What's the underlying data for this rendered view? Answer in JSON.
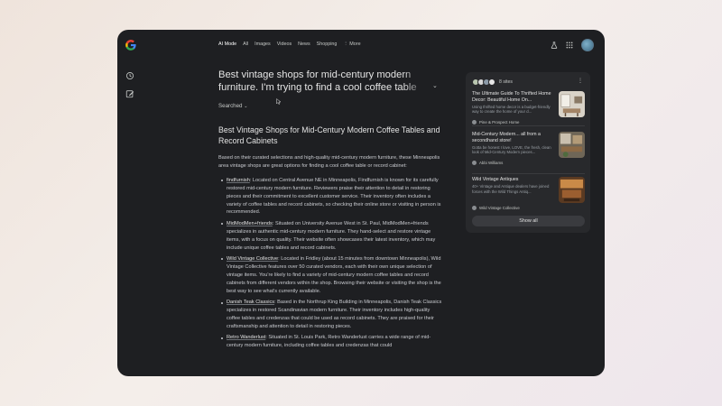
{
  "nav": {
    "tabs": [
      {
        "label": "AI Mode",
        "active": true
      },
      {
        "label": "All",
        "active": false
      },
      {
        "label": "Images",
        "active": false
      },
      {
        "label": "Videos",
        "active": false
      },
      {
        "label": "News",
        "active": false
      },
      {
        "label": "Shopping",
        "active": false
      },
      {
        "label": "⋮ More",
        "active": false
      }
    ]
  },
  "query": "Best vintage shops for mid-century modern furniture. I'm trying to find a cool coffee table or record cabinet",
  "searched_label": "Searched",
  "answer": {
    "title": "Best Vintage Shops for Mid-Century Modern Coffee Tables and Record Cabinets",
    "intro": "Based on their curated selections and high-quality mid-century modern furniture, these Minneapolis area vintage shops are great options for finding a cool coffee table or record cabinet:",
    "items": [
      {
        "name": "findfurnish",
        "text": ": Located on Central Avenue NE in Minneapolis, Findfurnish is known for its carefully restored mid-century modern furniture. Reviewers praise their attention to detail in restoring pieces and their commitment to excellent customer service. Their inventory often includes a variety of coffee tables and record cabinets, so checking their online store or visiting in person is recommended."
      },
      {
        "name": "MidModMen+friends",
        "text": ": Situated on University Avenue West in St. Paul, MidModMen+friends specializes in authentic mid-century modern furniture. They hand-select and restore vintage items, with a focus on quality. Their website often showcases their latest inventory, which may include unique coffee tables and record cabinets."
      },
      {
        "name": "Wild Vintage Collective",
        "text": ": Located in Fridley (about 15 minutes from downtown Minneapolis), Wild Vintage Collective features over 50 curated vendors, each with their own unique selection of vintage items. You're likely to find a variety of mid-century modern coffee tables and record cabinets from different vendors within the shop. Browsing their website or visiting the shop is the best way to see what's currently available."
      },
      {
        "name": "Danish Teak Classics",
        "text": ": Based in the Northrup King Building in Minneapolis, Danish Teak Classics specializes in restored Scandinavian modern furniture. Their inventory includes high-quality coffee tables and credenzas that could be used as record cabinets. They are praised for their craftsmanship and attention to detail in restoring pieces."
      },
      {
        "name": "Retro Wanderlust",
        "text": ": Situated in St. Louis Park, Retro Wanderlust carries a wide range of mid-century modern furniture, including coffee tables and credenzas that could"
      }
    ]
  },
  "sources": {
    "count_label": "8 sites",
    "cards": [
      {
        "title": "The Ultimate Guide To Thrifted Home Decor: Beautiful Home On...",
        "snippet": "Using thrifted home decor is a budget-friendly way to create the home of your d...",
        "source": "Pine & Prospect Home"
      },
      {
        "title": "Mid-Century Modern... all from a secondhand store!",
        "snippet": "Gotta be honest I love, LOVE, the fresh, clean look of Mid-Century Modern pieces...",
        "source": "Abbi Williams"
      },
      {
        "title": "Wild Vintage Antiques",
        "snippet": "40+ Vintage and Antique dealers have joined forces with the Wild Things Antiq...",
        "source": "Wild Vintage Collective"
      }
    ],
    "show_all_label": "Show all"
  },
  "colors": {
    "window_bg": "#1e1f22",
    "panel_bg": "#28292c",
    "text_primary": "#e3e3e3",
    "text_secondary": "#c9cbd0"
  }
}
